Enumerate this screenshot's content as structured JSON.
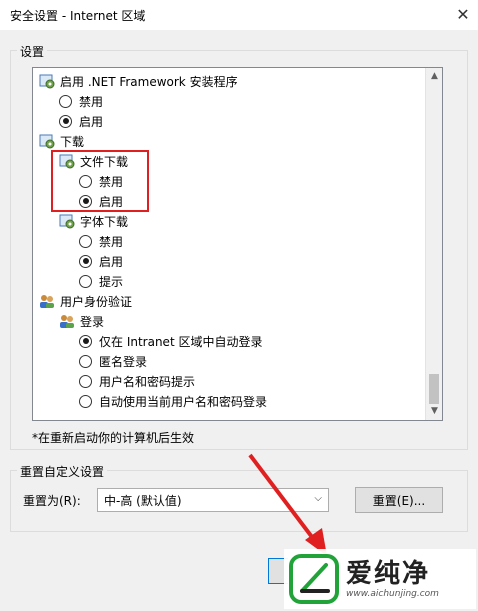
{
  "window": {
    "title": "安全设置 - Internet 区域",
    "close_label": "✕"
  },
  "settings_group": {
    "label": "设置",
    "items": [
      {
        "type": "category",
        "icon": "settings-gear-icon",
        "text": "启用 .NET Framework 安装程序"
      },
      {
        "type": "radio",
        "text": "禁用",
        "checked": false
      },
      {
        "type": "radio",
        "text": "启用",
        "checked": true
      },
      {
        "type": "category",
        "icon": "settings-gear-icon",
        "text": "下载"
      },
      {
        "type": "subcategory",
        "icon": "settings-gear-icon",
        "text": "文件下载"
      },
      {
        "type": "radio",
        "text": "禁用",
        "checked": false
      },
      {
        "type": "radio",
        "text": "启用",
        "checked": true
      },
      {
        "type": "subcategory",
        "icon": "settings-gear-icon",
        "text": "字体下载"
      },
      {
        "type": "radio",
        "text": "禁用",
        "checked": false
      },
      {
        "type": "radio",
        "text": "启用",
        "checked": true
      },
      {
        "type": "radio",
        "text": "提示",
        "checked": false
      },
      {
        "type": "category",
        "icon": "users-icon",
        "text": "用户身份验证"
      },
      {
        "type": "subcategory",
        "icon": "users-icon",
        "text": "登录"
      },
      {
        "type": "radio",
        "text": "仅在 Intranet 区域中自动登录",
        "checked": true
      },
      {
        "type": "radio",
        "text": "匿名登录",
        "checked": false
      },
      {
        "type": "radio",
        "text": "用户名和密码提示",
        "checked": false
      },
      {
        "type": "radio",
        "text": "自动使用当前用户名和密码登录",
        "checked": false
      }
    ],
    "note": "*在重新启动你的计算机后生效"
  },
  "reset_group": {
    "label": "重置自定义设置",
    "reset_to_label": "重置为(R):",
    "selected_level": "中-高 (默认值)",
    "reset_button": "重置(E)..."
  },
  "watermark": {
    "brand": "爱纯净",
    "url": "www.aichunjing.com"
  },
  "colors": {
    "highlight_border": "#e02020",
    "annotation_arrow": "#e02020",
    "brand_green": "#22a33a"
  }
}
